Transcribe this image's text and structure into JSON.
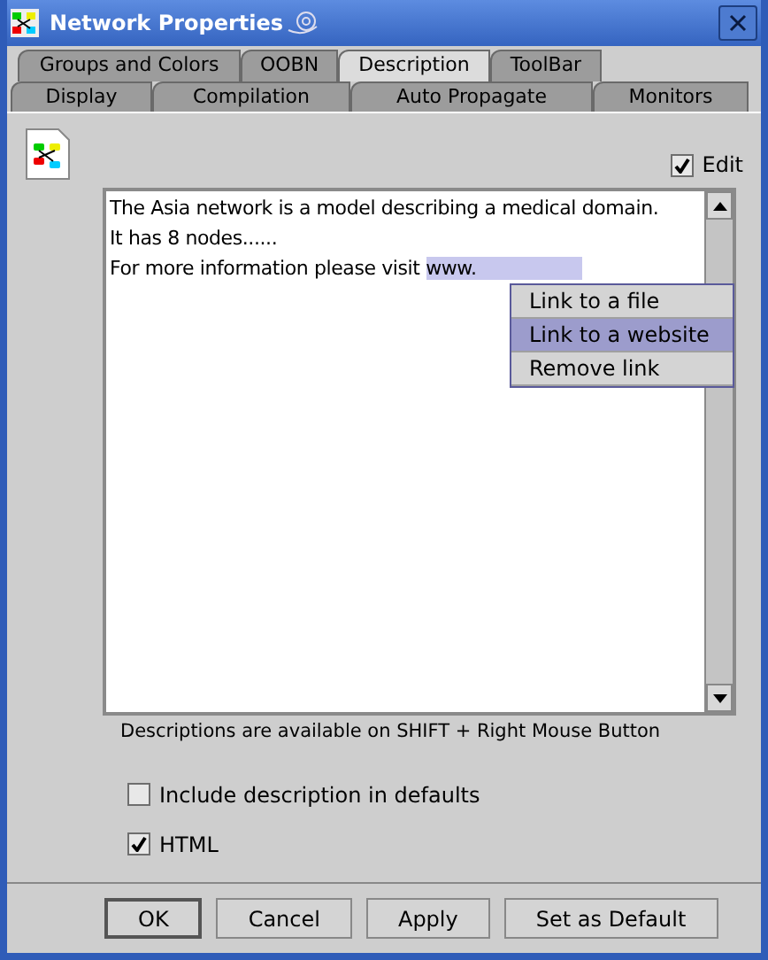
{
  "window": {
    "title": "Network Properties"
  },
  "tab_rows": [
    [
      {
        "label": "Groups and Colors",
        "selected": false
      },
      {
        "label": "OOBN",
        "selected": false
      },
      {
        "label": "Description",
        "selected": true
      },
      {
        "label": "ToolBar",
        "selected": false
      }
    ],
    [
      {
        "label": "Display",
        "selected": false
      },
      {
        "label": "Compilation",
        "selected": false
      },
      {
        "label": "Auto Propagate",
        "selected": false
      },
      {
        "label": "Monitors",
        "selected": false
      }
    ]
  ],
  "edit_checkbox": {
    "label": "Edit",
    "checked": true
  },
  "description": {
    "lines": [
      "The Asia network is a model describing a medical domain.",
      "It has 8 nodes......",
      "For more information please visit "
    ],
    "selected_text": "www."
  },
  "context_menu": [
    {
      "label": "Link to a file",
      "selected": false
    },
    {
      "label": "Link to a website",
      "selected": true
    },
    {
      "label": "Remove link",
      "selected": false
    }
  ],
  "hint": "Descriptions are available on SHIFT + Right Mouse Button",
  "options": [
    {
      "label": "Include description in defaults",
      "checked": false
    },
    {
      "label": "HTML",
      "checked": true
    }
  ],
  "buttons": [
    {
      "label": "OK",
      "default": true
    },
    {
      "label": "Cancel",
      "default": false
    },
    {
      "label": "Apply",
      "default": false
    },
    {
      "label": "Set as Default",
      "default": false
    }
  ]
}
